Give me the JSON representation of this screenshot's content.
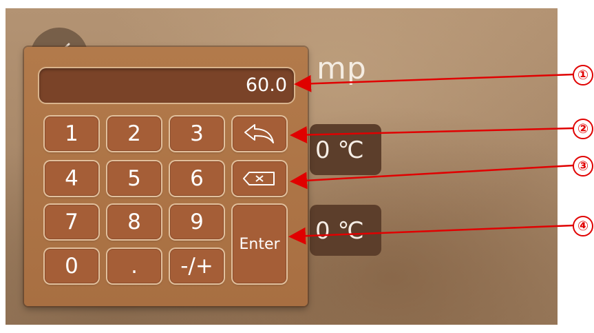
{
  "page": {
    "title_fragment": "mp",
    "temp_1": "0  ℃",
    "temp_2": "0 ℃"
  },
  "keypad": {
    "display_value": "60.0",
    "keys": {
      "k1": "1",
      "k2": "2",
      "k3": "3",
      "k4": "4",
      "k5": "5",
      "k6": "6",
      "k7": "7",
      "k8": "8",
      "k9": "9",
      "k0": "0",
      "dot": ".",
      "sign": "-/+",
      "enter": "Enter"
    },
    "icons": {
      "undo": "undo-arrow-icon",
      "backspace": "backspace-icon",
      "back": "checkmark-back-icon"
    }
  },
  "annotations": [
    "①",
    "②",
    "③",
    "④"
  ],
  "colors": {
    "annotation": "#e00000",
    "keypad_bg": "#b27a4b",
    "key_bg": "#a55e37"
  }
}
